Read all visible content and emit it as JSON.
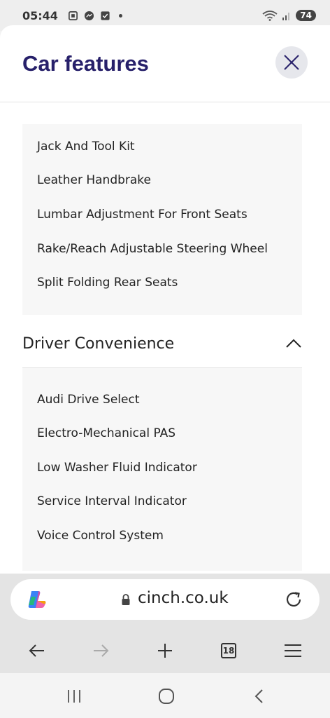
{
  "status_bar": {
    "time": "05:44",
    "battery": "74"
  },
  "modal": {
    "title": "Car features",
    "close_icon": "close-icon"
  },
  "groups": [
    {
      "items": [
        "Jack And Tool Kit",
        "Leather Handbrake",
        "Lumbar Adjustment For Front Seats",
        "Rake/Reach Adjustable Steering Wheel",
        "Split Folding Rear Seats"
      ]
    },
    {
      "title": "Driver Convenience",
      "expanded": true,
      "items": [
        "Audi Drive Select",
        "Electro-Mechanical PAS",
        "Low Washer Fluid Indicator",
        "Service Interval Indicator",
        "Voice Control System"
      ]
    }
  ],
  "browser": {
    "url": "cinch.co.uk",
    "tab_count": "18"
  },
  "colors": {
    "title": "#27206a",
    "close_bg": "#e6e7ec",
    "group_bg": "#f7f7f7",
    "browser_bg": "#e4e4e4"
  }
}
